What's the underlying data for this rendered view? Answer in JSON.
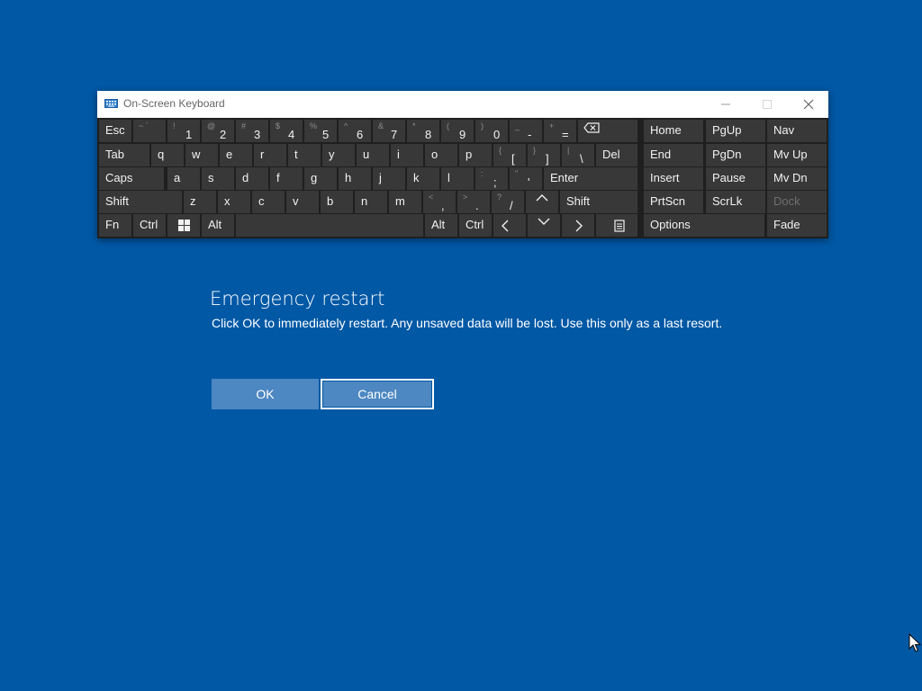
{
  "osk": {
    "title": "On-Screen Keyboard",
    "rows": [
      [
        {
          "label": "Esc"
        },
        {
          "secondary": "~ `",
          "primary": ""
        },
        {
          "secondary": "!",
          "primary": "1"
        },
        {
          "secondary": "@",
          "primary": "2"
        },
        {
          "secondary": "#",
          "primary": "3"
        },
        {
          "secondary": "$",
          "primary": "4"
        },
        {
          "secondary": "%",
          "primary": "5"
        },
        {
          "secondary": "^",
          "primary": "6"
        },
        {
          "secondary": "&",
          "primary": "7"
        },
        {
          "secondary": "*",
          "primary": "8"
        },
        {
          "secondary": "(",
          "primary": "9"
        },
        {
          "secondary": ")",
          "primary": "0"
        },
        {
          "secondary": "_",
          "primary": "-"
        },
        {
          "secondary": "+",
          "primary": "="
        },
        {
          "icon": "backspace-icon"
        },
        {
          "label": "Home"
        },
        {
          "label": "PgUp"
        },
        {
          "label": "Nav"
        }
      ],
      [
        {
          "label": "Tab"
        },
        {
          "label": "q"
        },
        {
          "label": "w"
        },
        {
          "label": "e"
        },
        {
          "label": "r"
        },
        {
          "label": "t"
        },
        {
          "label": "y"
        },
        {
          "label": "u"
        },
        {
          "label": "i"
        },
        {
          "label": "o"
        },
        {
          "label": "p"
        },
        {
          "secondary": "{",
          "primary": "["
        },
        {
          "secondary": "}",
          "primary": "]"
        },
        {
          "secondary": "|",
          "primary": "\\"
        },
        {
          "label": "Del"
        },
        {
          "label": "End"
        },
        {
          "label": "PgDn"
        },
        {
          "label": "Mv Up"
        }
      ],
      [
        {
          "label": "Caps"
        },
        {
          "label": "a"
        },
        {
          "label": "s"
        },
        {
          "label": "d"
        },
        {
          "label": "f"
        },
        {
          "label": "g"
        },
        {
          "label": "h"
        },
        {
          "label": "j"
        },
        {
          "label": "k"
        },
        {
          "label": "l"
        },
        {
          "secondary": ":",
          "primary": ";"
        },
        {
          "secondary": "\"",
          "primary": "'"
        },
        {
          "label": "Enter"
        },
        {
          "label": "Insert"
        },
        {
          "label": "Pause"
        },
        {
          "label": "Mv Dn"
        }
      ],
      [
        {
          "label": "Shift"
        },
        {
          "label": "z"
        },
        {
          "label": "x"
        },
        {
          "label": "c"
        },
        {
          "label": "v"
        },
        {
          "label": "b"
        },
        {
          "label": "n"
        },
        {
          "label": "m"
        },
        {
          "secondary": "<",
          "primary": ","
        },
        {
          "secondary": ">",
          "primary": "."
        },
        {
          "secondary": "?",
          "primary": "/"
        },
        {
          "icon": "arrow-up-icon"
        },
        {
          "label": "Shift"
        },
        {
          "label": "PrtScn"
        },
        {
          "label": "ScrLk"
        },
        {
          "label": "Dock",
          "disabled": true
        }
      ],
      [
        {
          "label": "Fn"
        },
        {
          "label": "Ctrl"
        },
        {
          "icon": "windows-icon"
        },
        {
          "label": "Alt"
        },
        {
          "label": ""
        },
        {
          "label": "Alt"
        },
        {
          "label": "Ctrl"
        },
        {
          "icon": "arrow-left-icon"
        },
        {
          "icon": "arrow-down-icon"
        },
        {
          "icon": "arrow-right-icon"
        },
        {
          "icon": "menu-key-icon"
        },
        {
          "label": "Options"
        },
        {
          "label": "Fade"
        }
      ]
    ]
  },
  "dialog": {
    "title": "Emergency restart",
    "message": "Click OK to immediately restart. Any unsaved data will be lost. Use this only as a last resort.",
    "ok_label": "OK",
    "cancel_label": "Cancel"
  },
  "colors": {
    "background": "#0158a5",
    "button": "#4d88c2",
    "key": "#383838",
    "keyboard_frame": "#1f1f1f"
  }
}
